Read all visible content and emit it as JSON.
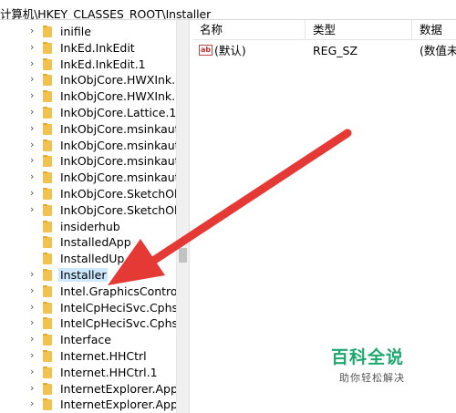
{
  "address_bar": {
    "path": "计算机\\HKEY_CLASSES_ROOT\\Installer"
  },
  "tree": {
    "items": [
      {
        "label": "inifile",
        "expandable": true
      },
      {
        "label": "InkEd.InkEdit",
        "expandable": true
      },
      {
        "label": "InkEd.InkEdit.1",
        "expandable": true
      },
      {
        "label": "InkObjCore.HWXInk.E",
        "expandable": true
      },
      {
        "label": "InkObjCore.HWXInk.E",
        "expandable": true
      },
      {
        "label": "InkObjCore.Lattice.1",
        "expandable": true
      },
      {
        "label": "InkObjCore.msinkaut.I",
        "expandable": true
      },
      {
        "label": "InkObjCore.msinkaut.I",
        "expandable": true
      },
      {
        "label": "InkObjCore.msinkaut.I",
        "expandable": true
      },
      {
        "label": "InkObjCore.msinkaut.I",
        "expandable": true
      },
      {
        "label": "InkObjCore.SketchOb",
        "expandable": true
      },
      {
        "label": "InkObjCore.SketchOb",
        "expandable": true
      },
      {
        "label": "insiderhub",
        "expandable": false
      },
      {
        "label": "InstalledApp",
        "expandable": false
      },
      {
        "label": "InstalledUp",
        "expandable": false
      },
      {
        "label": "Installer",
        "expandable": true,
        "selected": true
      },
      {
        "label": "Intel.GraphicsControll",
        "expandable": true
      },
      {
        "label": "IntelCpHeciSvc.CphsS",
        "expandable": true
      },
      {
        "label": "IntelCpHeciSvc.CphsS",
        "expandable": true
      },
      {
        "label": "Interface",
        "expandable": true
      },
      {
        "label": "Internet.HHCtrl",
        "expandable": true
      },
      {
        "label": "Internet.HHCtrl.1",
        "expandable": true
      },
      {
        "label": "InternetExplorer.Appl",
        "expandable": true
      },
      {
        "label": "InternetExplorer.Appl",
        "expandable": true
      }
    ]
  },
  "values_pane": {
    "columns": {
      "name": "名称",
      "type": "类型",
      "data": "数据"
    },
    "rows": [
      {
        "icon": "string-value-icon",
        "icon_text": "ab",
        "name": "(默认)",
        "type": "REG_SZ",
        "data": "(数值未设置)"
      }
    ]
  },
  "annotation": {
    "color": "#e53935"
  },
  "watermark": {
    "title": "百科全说",
    "subtitle": "助你轻松解决",
    "color": "#1ea86f"
  }
}
